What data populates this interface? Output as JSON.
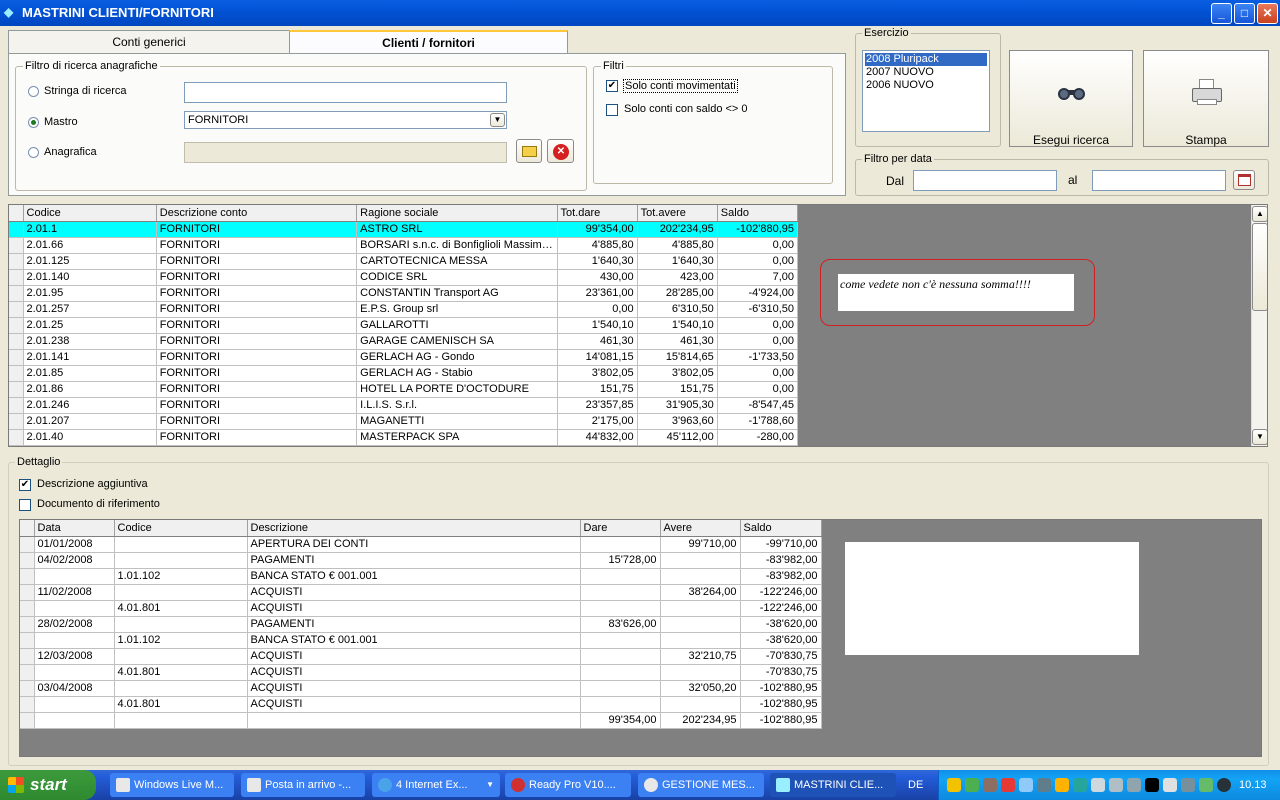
{
  "window": {
    "title": "MASTRINI CLIENTI/FORNITORI",
    "min": "_",
    "max": "□",
    "close": "✕"
  },
  "tabs": [
    {
      "label": "Conti generici"
    },
    {
      "label": "Clienti / fornitori"
    }
  ],
  "search": {
    "group_label": "Filtro di ricerca anagrafiche",
    "stringa_label": "Stringa di ricerca",
    "stringa_value": "",
    "mastro_label": "Mastro",
    "mastro_value": "FORNITORI",
    "anagrafica_label": "Anagrafica",
    "anagrafica_value": ""
  },
  "filtri": {
    "group_label": "Filtri",
    "solo_movimentati_label": "Solo conti movimentati",
    "solo_movimentati_checked": true,
    "solo_saldo_label": "Solo conti con saldo <> 0",
    "solo_saldo_checked": false
  },
  "esercizio": {
    "label": "Esercizio",
    "items": [
      "2008 Pluripack",
      "2007 NUOVO",
      "2006 NUOVO"
    ],
    "selected": 0
  },
  "actions": {
    "search_label": "Esegui ricerca",
    "print_label": "Stampa"
  },
  "filtro_data": {
    "label": "Filtro per data",
    "dal_label": "Dal",
    "al_label": "al",
    "dal_value": "",
    "al_value": ""
  },
  "conti_table": {
    "headers": [
      "Codice",
      "Descrizione conto",
      "Ragione sociale",
      "Tot.dare",
      "Tot.avere",
      "Saldo"
    ],
    "rows": [
      [
        "2.01.1",
        "FORNITORI",
        "ASTRO SRL",
        "99'354,00",
        "202'234,95",
        "-102'880,95"
      ],
      [
        "2.01.66",
        "FORNITORI",
        "BORSARI s.n.c. di Bonfiglioli Massimo ...",
        "4'885,80",
        "4'885,80",
        "0,00"
      ],
      [
        "2.01.125",
        "FORNITORI",
        "CARTOTECNICA MESSA",
        "1'640,30",
        "1'640,30",
        "0,00"
      ],
      [
        "2.01.140",
        "FORNITORI",
        "CODICE SRL",
        "430,00",
        "423,00",
        "7,00"
      ],
      [
        "2.01.95",
        "FORNITORI",
        "CONSTANTIN Transport AG",
        "23'361,00",
        "28'285,00",
        "-4'924,00"
      ],
      [
        "2.01.257",
        "FORNITORI",
        "E.P.S. Group srl",
        "0,00",
        "6'310,50",
        "-6'310,50"
      ],
      [
        "2.01.25",
        "FORNITORI",
        "GALLAROTTI",
        "1'540,10",
        "1'540,10",
        "0,00"
      ],
      [
        "2.01.238",
        "FORNITORI",
        "GARAGE CAMENISCH SA",
        "461,30",
        "461,30",
        "0,00"
      ],
      [
        "2.01.141",
        "FORNITORI",
        "GERLACH AG - Gondo",
        "14'081,15",
        "15'814,65",
        "-1'733,50"
      ],
      [
        "2.01.85",
        "FORNITORI",
        "GERLACH AG - Stabio",
        "3'802,05",
        "3'802,05",
        "0,00"
      ],
      [
        "2.01.86",
        "FORNITORI",
        "HOTEL LA PORTE D'OCTODURE",
        "151,75",
        "151,75",
        "0,00"
      ],
      [
        "2.01.246",
        "FORNITORI",
        "I.L.I.S. S.r.l.",
        "23'357,85",
        "31'905,30",
        "-8'547,45"
      ],
      [
        "2.01.207",
        "FORNITORI",
        "MAGANETTI",
        "2'175,00",
        "3'963,60",
        "-1'788,60"
      ],
      [
        "2.01.40",
        "FORNITORI",
        "MASTERPACK SPA",
        "44'832,00",
        "45'112,00",
        "-280,00"
      ]
    ]
  },
  "annotation": "come vedete non c'è nessuna somma!!!!",
  "dettaglio": {
    "label": "Dettaglio",
    "desc_agg_label": "Descrizione aggiuntiva",
    "desc_agg_checked": true,
    "doc_rif_label": "Documento di riferimento",
    "doc_rif_checked": false
  },
  "movimenti_table": {
    "headers": [
      "Data",
      "Codice",
      "Descrizione",
      "Dare",
      "Avere",
      "Saldo"
    ],
    "rows": [
      [
        "01/01/2008",
        "",
        "APERTURA DEI CONTI",
        "",
        "99'710,00",
        "-99'710,00"
      ],
      [
        "04/02/2008",
        "",
        "PAGAMENTI",
        "15'728,00",
        "",
        "-83'982,00"
      ],
      [
        "",
        "1.01.102",
        "BANCA STATO € 001.001",
        "",
        "",
        "-83'982,00"
      ],
      [
        "11/02/2008",
        "",
        "ACQUISTI",
        "",
        "38'264,00",
        "-122'246,00"
      ],
      [
        "",
        "4.01.801",
        "ACQUISTI",
        "",
        "",
        "-122'246,00"
      ],
      [
        "28/02/2008",
        "",
        "PAGAMENTI",
        "83'626,00",
        "",
        "-38'620,00"
      ],
      [
        "",
        "1.01.102",
        "BANCA STATO € 001.001",
        "",
        "",
        "-38'620,00"
      ],
      [
        "12/03/2008",
        "",
        "ACQUISTI",
        "",
        "32'210,75",
        "-70'830,75"
      ],
      [
        "",
        "4.01.801",
        "ACQUISTI",
        "",
        "",
        "-70'830,75"
      ],
      [
        "03/04/2008",
        "",
        "ACQUISTI",
        "",
        "32'050,20",
        "-102'880,95"
      ],
      [
        "",
        "4.01.801",
        "ACQUISTI",
        "",
        "",
        "-102'880,95"
      ],
      [
        "",
        "",
        "",
        "99'354,00",
        "202'234,95",
        "-102'880,95"
      ]
    ]
  },
  "taskbar": {
    "start": "start",
    "tasks": [
      "Windows Live M...",
      "Posta in arrivo -...",
      "4 Internet Ex...",
      "Ready Pro V10....",
      "GESTIONE MES...",
      "MASTRINI CLIE..."
    ],
    "lang": "DE",
    "clock": "10.13"
  }
}
